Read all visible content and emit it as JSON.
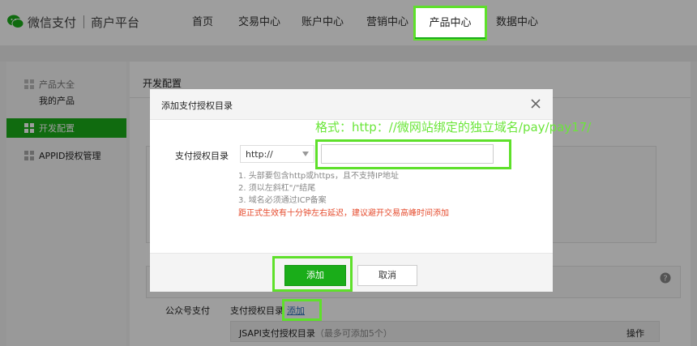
{
  "header": {
    "brand": "微信支付",
    "platform": "商户平台",
    "nav": [
      {
        "label": "首页"
      },
      {
        "label": "交易中心"
      },
      {
        "label": "账户中心"
      },
      {
        "label": "营销中心"
      },
      {
        "label": "产品中心"
      },
      {
        "label": "数据中心"
      }
    ]
  },
  "sidebar": {
    "group_label": "产品大全",
    "my_products": "我的产品",
    "active_item": "开发配置",
    "appid_item": "APPID授权管理"
  },
  "main": {
    "title": "开发配置",
    "row_pay": "公众号支付",
    "row_dir": "支付授权目录",
    "row_add": "添加",
    "table_head": "JSAPI支付授权目录",
    "table_head_note": "（最多可添加5个）",
    "table_action": "操作"
  },
  "dialog": {
    "title": "添加支付授权目录",
    "field_label": "支付授权目录",
    "protocol_selected": "http://",
    "path_value": "",
    "hints": [
      "1. 头部要包含http或https，且不支持IP地址",
      "2. 须以左斜杠\"/\"结尾",
      "3. 域名必须通过ICP备案"
    ],
    "warning": "距正式生效有十分钟左右延迟，建议避开交易高峰时间添加",
    "btn_add": "添加",
    "btn_cancel": "取消"
  },
  "annotation": "格式：http：//微网站绑定的独立域名/pay/pay17/",
  "colors": {
    "wechat_green": "#1aad19",
    "highlight_green": "#5ee02a",
    "warning_red": "#e54a2c",
    "link_blue": "#2b6fb8"
  }
}
